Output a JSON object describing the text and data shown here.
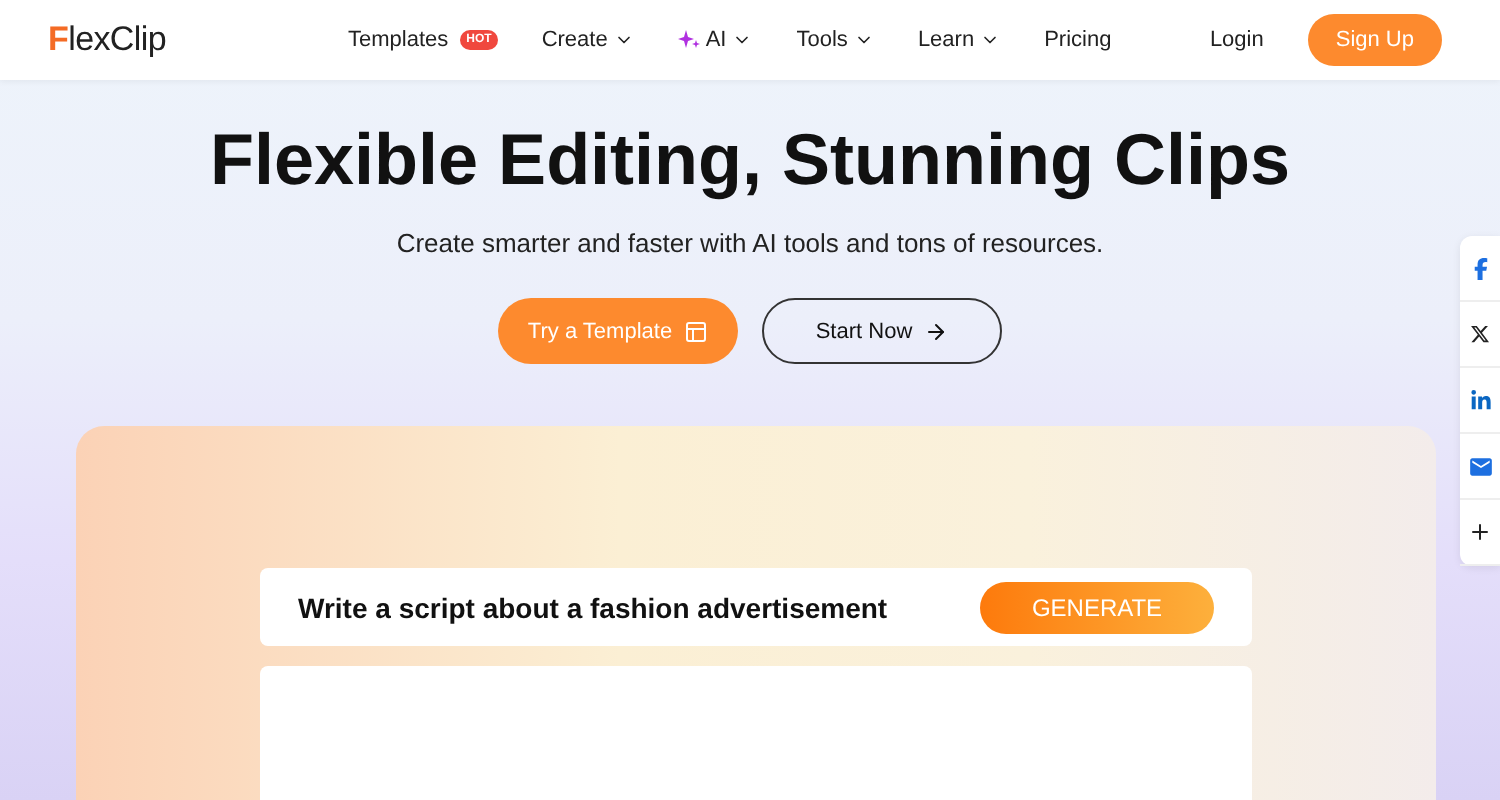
{
  "nav": {
    "logo": "FlexClip",
    "items": [
      {
        "label": "Templates",
        "kind": "plain",
        "badge": "HOT"
      },
      {
        "label": "Create",
        "kind": "dropdown"
      },
      {
        "label": "AI",
        "kind": "ai"
      },
      {
        "label": "Tools",
        "kind": "dropdown"
      },
      {
        "label": "Learn",
        "kind": "dropdown"
      },
      {
        "label": "Pricing",
        "kind": "plain"
      }
    ],
    "login": "Login",
    "signup": "Sign Up"
  },
  "hero": {
    "title": "Flexible Editing, Stunning Clips",
    "subtitle": "Create smarter and faster with AI tools and tons of resources.",
    "primary": "Try a Template",
    "secondary": "Start Now"
  },
  "prompt": {
    "text": "Write a script about a fashion advertisement",
    "button": "GENERATE"
  },
  "share": [
    {
      "kind": "facebook"
    },
    {
      "kind": "x"
    },
    {
      "kind": "linkedin"
    },
    {
      "kind": "email"
    },
    {
      "kind": "more"
    }
  ]
}
